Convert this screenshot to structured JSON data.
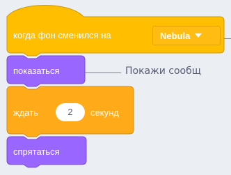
{
  "blocks": {
    "hat": {
      "prefix": "когда фон сменился на",
      "dropdown_value": "Nebula",
      "color": "#ffbf00"
    },
    "show": {
      "label": "показаться",
      "color": "#9966ff"
    },
    "wait": {
      "label_before": "ждать",
      "value": "2",
      "label_after": "секунд",
      "color": "#ffab19"
    },
    "hide": {
      "label": "спрятаться",
      "color": "#9966ff"
    }
  },
  "callouts": {
    "show_comment": "Покажи сообщ"
  }
}
